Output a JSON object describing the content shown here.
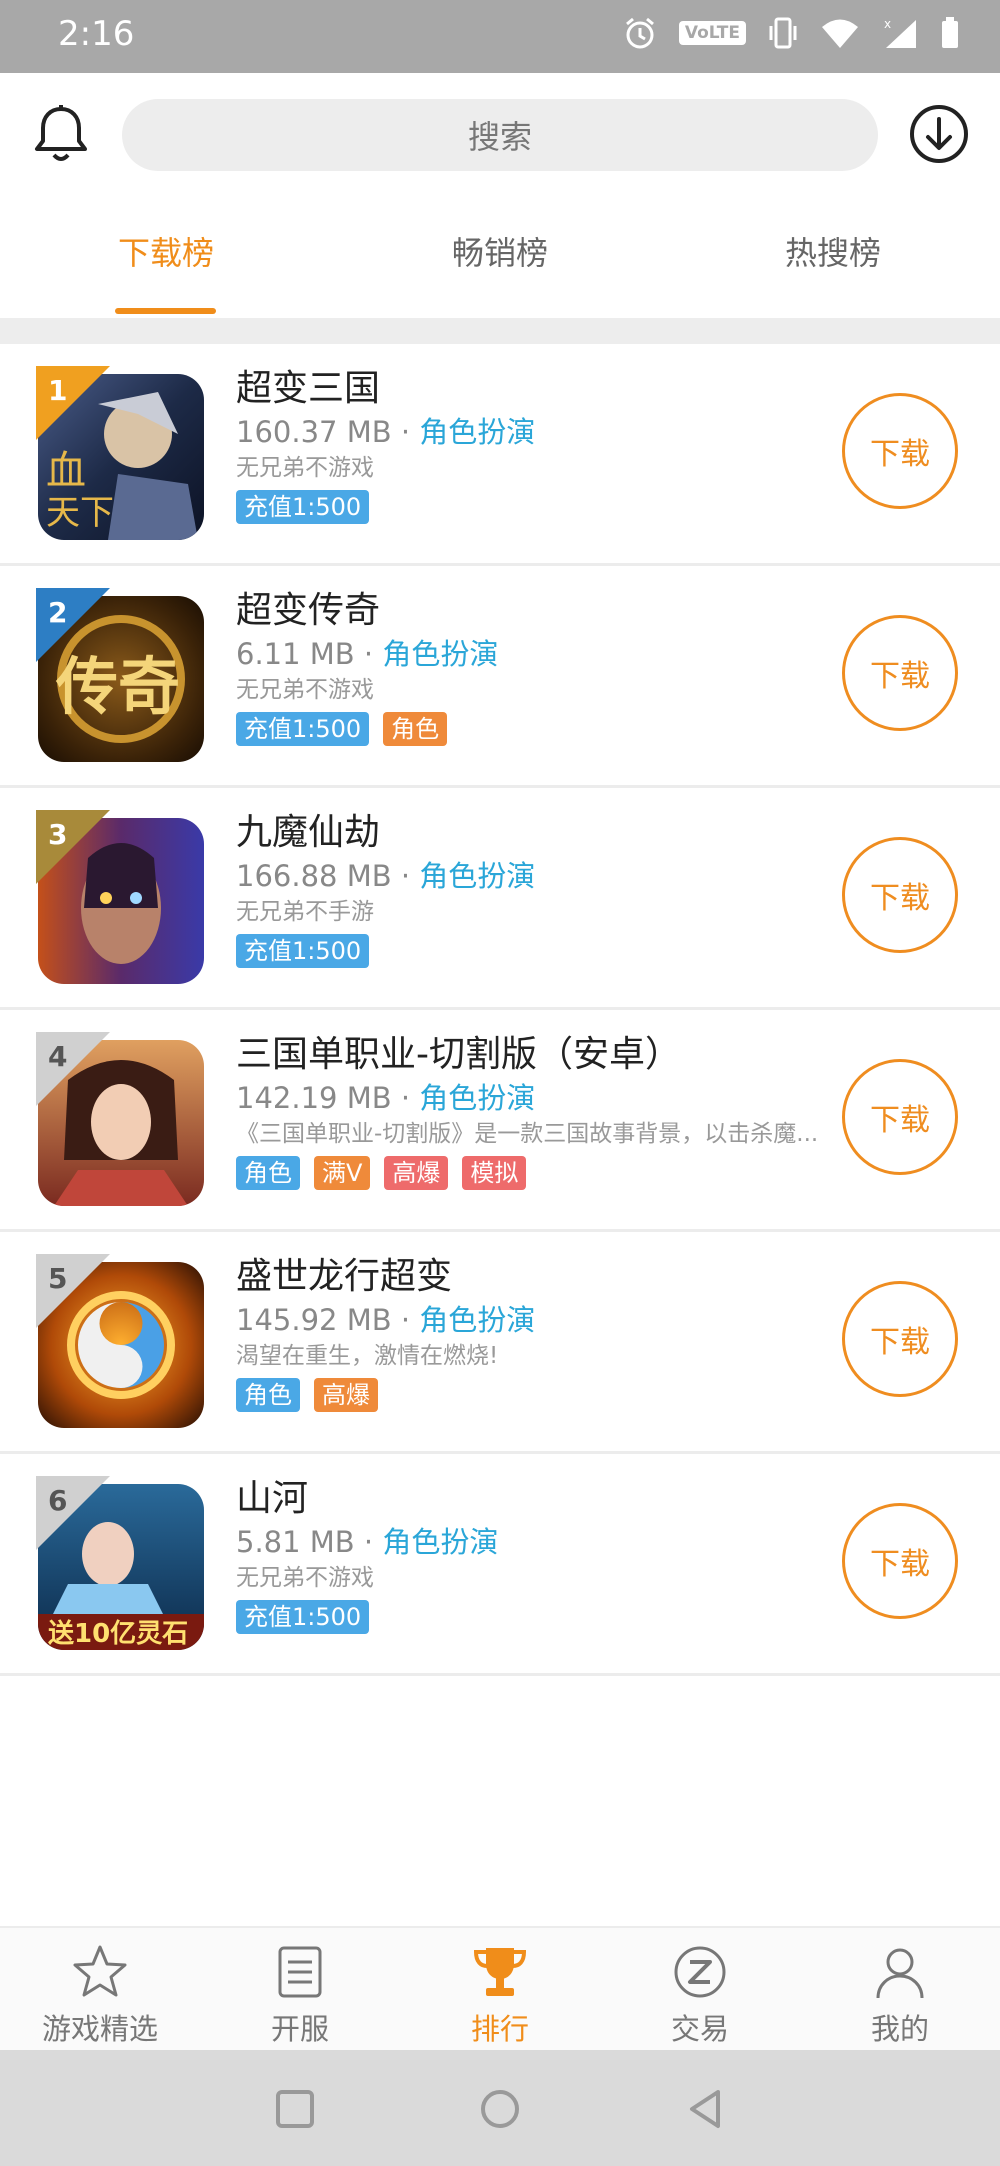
{
  "status_bar": {
    "time": "2:16",
    "volte": "VoLTE"
  },
  "search": {
    "placeholder": "搜索"
  },
  "tabs": [
    {
      "label": "下载榜",
      "active": true
    },
    {
      "label": "畅销榜",
      "active": false
    },
    {
      "label": "热搜榜",
      "active": false
    }
  ],
  "games": [
    {
      "rank": "1",
      "name": "超变三国",
      "size": "160.37 MB",
      "category": "角色扮演",
      "desc": "无兄弟不游戏",
      "tags": [
        {
          "label": "充值1:500",
          "color": "#4aa8e6"
        }
      ],
      "button": "下载"
    },
    {
      "rank": "2",
      "name": "超变传奇",
      "size": "6.11 MB",
      "category": "角色扮演",
      "desc": "无兄弟不游戏",
      "tags": [
        {
          "label": "充值1:500",
          "color": "#4aa8e6"
        },
        {
          "label": "角色",
          "color": "#ef8a3a"
        }
      ],
      "button": "下载"
    },
    {
      "rank": "3",
      "name": "九魔仙劫",
      "size": "166.88 MB",
      "category": "角色扮演",
      "desc": "无兄弟不手游",
      "tags": [
        {
          "label": "充值1:500",
          "color": "#4aa8e6"
        }
      ],
      "button": "下载"
    },
    {
      "rank": "4",
      "name": "三国单职业-切割版（安卓）",
      "size": "142.19 MB",
      "category": "角色扮演",
      "desc": "《三国单职业-切割版》是一款三国故事背景，以击杀魔...",
      "tags": [
        {
          "label": "角色",
          "color": "#4aa8e6"
        },
        {
          "label": "满V",
          "color": "#ef8a3a"
        },
        {
          "label": "高爆",
          "color": "#ee6b6b"
        },
        {
          "label": "模拟",
          "color": "#ee6b6b"
        }
      ],
      "button": "下载"
    },
    {
      "rank": "5",
      "name": "盛世龙行超变",
      "size": "145.92 MB",
      "category": "角色扮演",
      "desc": "渴望在重生，激情在燃烧!",
      "tags": [
        {
          "label": "角色",
          "color": "#4aa8e6"
        },
        {
          "label": "高爆",
          "color": "#ef8a3a"
        }
      ],
      "button": "下载"
    },
    {
      "rank": "6",
      "name": "山河",
      "size": "5.81 MB",
      "category": "角色扮演",
      "desc": "无兄弟不游戏",
      "tags": [
        {
          "label": "充值1:500",
          "color": "#4aa8e6"
        }
      ],
      "button": "下载"
    }
  ],
  "bottom_nav": [
    {
      "label": "游戏精选",
      "icon": "star-icon",
      "active": false
    },
    {
      "label": "开服",
      "icon": "list-icon",
      "active": false
    },
    {
      "label": "排行",
      "icon": "trophy-icon",
      "active": true
    },
    {
      "label": "交易",
      "icon": "exchange-icon",
      "active": false
    },
    {
      "label": "我的",
      "icon": "user-icon",
      "active": false
    }
  ],
  "colors": {
    "accent": "#f08d1a",
    "category": "#2aa6d8",
    "rank1": "#f0a020",
    "rank2": "#2d7ec4",
    "rank3": "#a88a3a",
    "rank_other": "#d0d0d0"
  }
}
